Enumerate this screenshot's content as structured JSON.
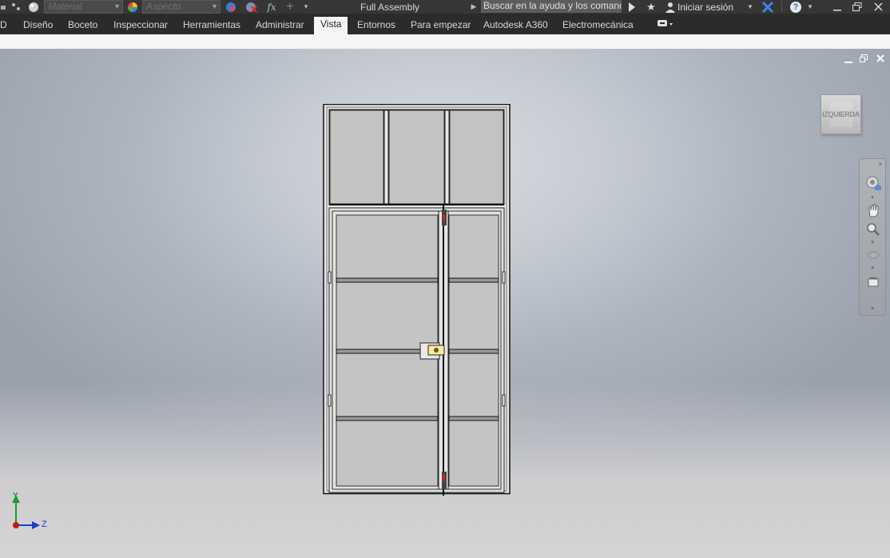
{
  "titlebar": {
    "material_placeholder": "Material",
    "appearance_placeholder": "Aspecto",
    "fx_label": "fx",
    "document_title": "Full Assembly",
    "search_text": "Buscar en la ayuda y los comanc",
    "signin_label": "Iniciar sesión",
    "help_label": "?"
  },
  "ribbon": {
    "tabs": [
      {
        "label": "D"
      },
      {
        "label": "Diseño"
      },
      {
        "label": "Boceto"
      },
      {
        "label": "Inspeccionar"
      },
      {
        "label": "Herramientas"
      },
      {
        "label": "Administrar"
      },
      {
        "label": "Vista"
      },
      {
        "label": "Entornos"
      },
      {
        "label": "Para empezar"
      },
      {
        "label": "Autodesk A360"
      },
      {
        "label": "Electromecánica"
      }
    ],
    "active_tab": "Vista"
  },
  "viewport": {
    "viewcube_label": "IZQUIERDA",
    "axis": {
      "y": "Y",
      "z": "Z"
    },
    "window_controls": {
      "minimize": "‒",
      "restore": "❐",
      "close": "✕"
    }
  },
  "colors": {
    "accent_blue": "#2b6cc4",
    "axis_green": "#1c9b2f",
    "axis_blue": "#1a3fc9",
    "axis_red": "#c21a1a"
  }
}
